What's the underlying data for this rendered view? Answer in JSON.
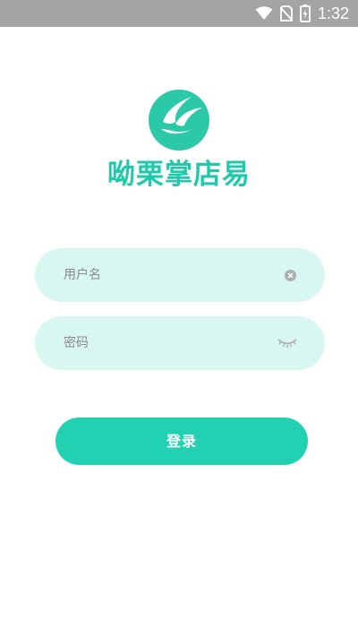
{
  "status_bar": {
    "time": "1:32",
    "icons": [
      "wifi-icon",
      "no-sim-icon",
      "battery-charging-icon"
    ]
  },
  "app": {
    "name": "呦栗掌店易",
    "logo": "leaf-logo",
    "accent_color": "#21c9ab"
  },
  "form": {
    "username": {
      "placeholder": "用户名",
      "value": "",
      "trailing_icon": "clear-icon"
    },
    "password": {
      "placeholder": "密码",
      "value": "",
      "trailing_icon": "eye-closed-icon"
    },
    "login_label": "登录",
    "field_color": "#d8f7f1",
    "button_color": "#21d1b1"
  }
}
